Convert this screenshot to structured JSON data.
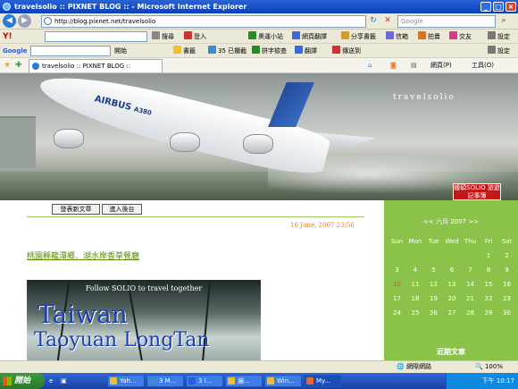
{
  "window": {
    "title": "travelsolio :: PIXNET BLOG :: - Microsoft Internet Explorer",
    "min": "_",
    "max": "□",
    "close": "×"
  },
  "address": {
    "url": "http://blog.pixnet.net/travelsolio",
    "search_placeholder": "Google"
  },
  "yahoo_toolbar": {
    "logo": "Y!",
    "items": [
      "搜尋",
      "登入",
      "奧運小站",
      "網頁翻譯",
      "分享書籤",
      "信箱",
      "拍賣",
      "交友",
      "設定"
    ]
  },
  "google_toolbar": {
    "logo": "Google",
    "items": [
      "開始",
      "書籤",
      "35 已攔截",
      "拼字檢查",
      "翻譯",
      "傳送到",
      "設定"
    ]
  },
  "tab": {
    "label": "travelsolio :: PIXNET BLOG ::"
  },
  "cmdbar": {
    "page": "網頁(P)",
    "tools": "工具(O)"
  },
  "banner": {
    "title": "travelsolio",
    "airline": "AIRBUS",
    "model": "A380",
    "stamp": "鍾碩SOLIO 旅遊記事簿"
  },
  "post": {
    "btn_new": "發表新文章",
    "btn_admin": "進入後台",
    "date": "10 June, 2007 23:56",
    "title": "桃園縣龍潭鄉．湖水岸香草餐廳",
    "image_caption": "Follow SOLIO to travel together",
    "image_line1": "Taiwan",
    "image_line2": "Taoyuan LongTan"
  },
  "calendar": {
    "header": "<< 六月 2007 >>",
    "weekdays": [
      "Sun",
      "Mon",
      "Tue",
      "Wed",
      "Thu",
      "Fri",
      "Sat"
    ],
    "weeks": [
      [
        "",
        "",
        "",
        "",
        "",
        "1",
        "2"
      ],
      [
        "3",
        "4",
        "5",
        "6",
        "7",
        "8",
        "9"
      ],
      [
        "10",
        "11",
        "12",
        "13",
        "14",
        "15",
        "16"
      ],
      [
        "17",
        "18",
        "19",
        "20",
        "21",
        "22",
        "23"
      ],
      [
        "24",
        "25",
        "26",
        "27",
        "28",
        "29",
        "30"
      ]
    ]
  },
  "sidebar": {
    "recent_title": "近期文章"
  },
  "status": {
    "zone": "網際網路",
    "zoom": "100%"
  },
  "taskbar": {
    "start": "開始",
    "tasks": [
      "Yah...",
      "3 M...",
      "3 I...",
      "遍...",
      "Win...",
      "My..."
    ],
    "clock": "下午 10:17"
  },
  "colors": {
    "accent_green": "#8bc34a",
    "date_orange": "#e07a2e",
    "xp_blue": "#2a63d8"
  }
}
